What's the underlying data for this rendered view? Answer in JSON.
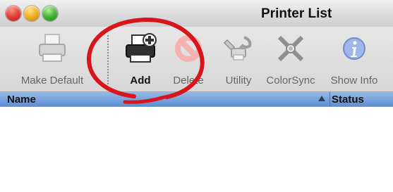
{
  "window": {
    "title": "Printer List"
  },
  "toolbar": {
    "items": [
      {
        "label": "Make Default",
        "icon": "printer-default-icon",
        "enabled": false
      },
      {
        "label": "Add",
        "icon": "printer-add-icon",
        "enabled": true
      },
      {
        "label": "Delete",
        "icon": "delete-icon",
        "enabled": false
      },
      {
        "label": "Utility",
        "icon": "utility-icon",
        "enabled": false
      },
      {
        "label": "ColorSync",
        "icon": "colorsync-icon",
        "enabled": false
      },
      {
        "label": "Show Info",
        "icon": "info-icon",
        "enabled": false
      }
    ]
  },
  "list": {
    "columns": [
      "Name",
      "Status"
    ],
    "sort_column": "Name",
    "sort_direction": "ascending",
    "rows": []
  },
  "colors": {
    "header_blue": "#5d8fd4",
    "annotation_red": "#d9141a"
  }
}
